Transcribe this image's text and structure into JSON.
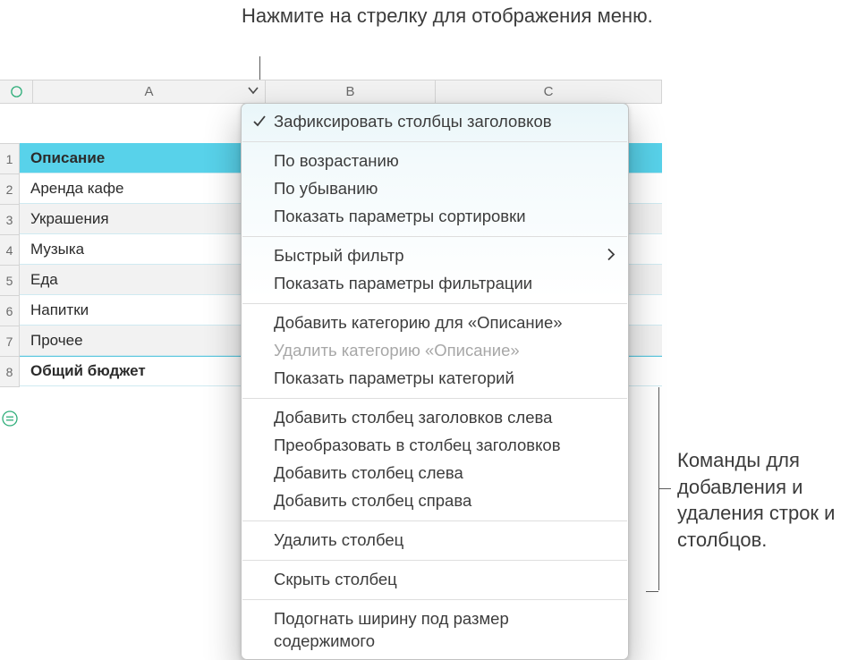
{
  "callouts": {
    "top": "Нажмите на стрелку для отображения меню.",
    "right": "Команды для добавления и удаления строк и столбцов."
  },
  "columns": {
    "A": "A",
    "B": "B",
    "C": "C"
  },
  "row_numbers": [
    "1",
    "2",
    "3",
    "4",
    "5",
    "6",
    "7",
    "8"
  ],
  "table": {
    "header": "Описание",
    "rows": [
      "Аренда кафе",
      "Украшения",
      "Музыка",
      "Еда",
      "Напитки",
      "Прочее"
    ],
    "total": "Общий бюджет"
  },
  "menu": {
    "freeze": "Зафиксировать столбцы заголовков",
    "sort_asc": "По возрастанию",
    "sort_desc": "По убыванию",
    "sort_opts": "Показать параметры сортировки",
    "quick_filter": "Быстрый фильтр",
    "filter_opts": "Показать параметры фильтрации",
    "add_cat": "Добавить категорию для «Описание»",
    "del_cat": "Удалить категорию «Описание»",
    "cat_opts": "Показать параметры категорий",
    "add_hdr_left": "Добавить столбец заголовков слева",
    "convert_hdr": "Преобразовать в столбец заголовков",
    "add_left": "Добавить столбец слева",
    "add_right": "Добавить столбец справа",
    "delete": "Удалить столбец",
    "hide": "Скрыть столбец",
    "fit": "Подогнать ширину под размер содержимого"
  }
}
